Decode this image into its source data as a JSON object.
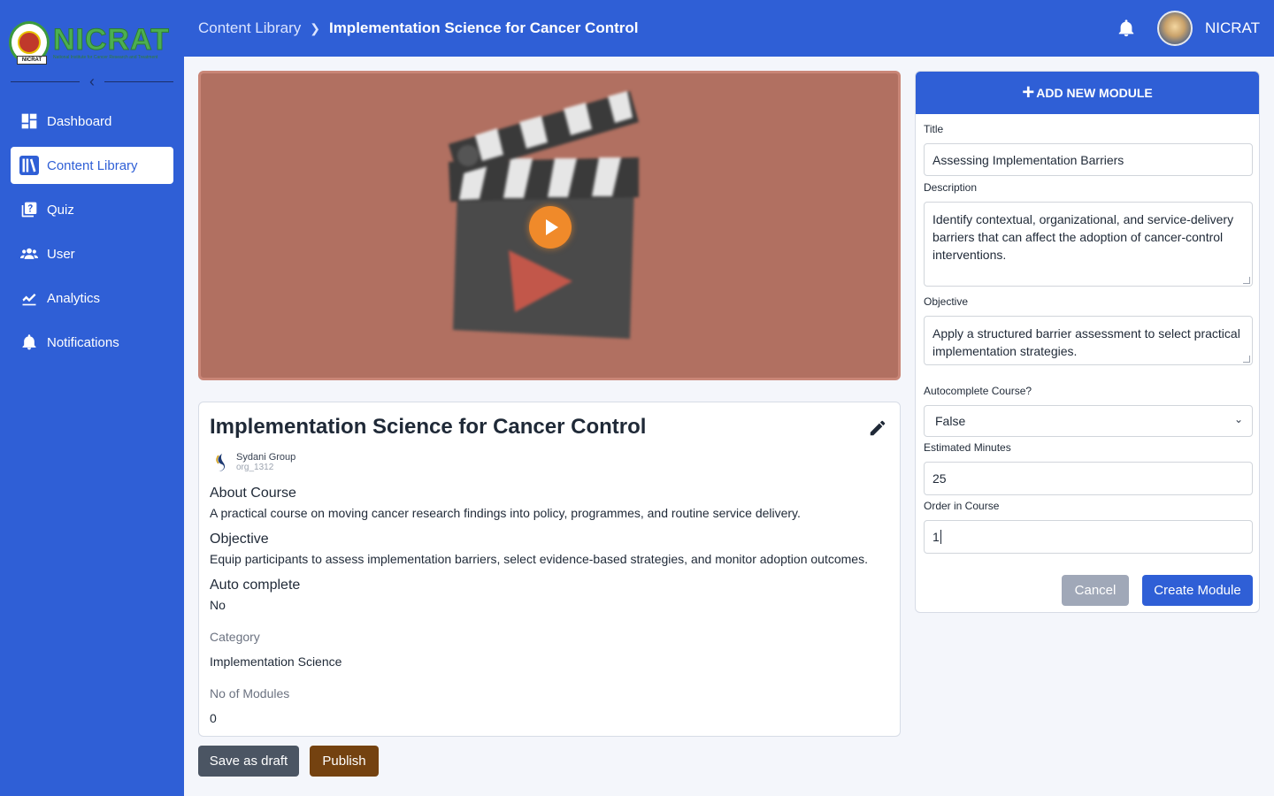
{
  "brand": {
    "name": "NICRAT",
    "tagline": "National Institute for Cancer Research and Treatment",
    "seal_label": "NICRAT",
    "primary_color": "#2f5fd6"
  },
  "sidebar": {
    "items": [
      {
        "label": "Dashboard",
        "icon": "dashboard-icon",
        "active": false
      },
      {
        "label": "Content Library",
        "icon": "library-icon",
        "active": true
      },
      {
        "label": "Quiz",
        "icon": "quiz-icon",
        "active": false
      },
      {
        "label": "User",
        "icon": "users-icon",
        "active": false
      },
      {
        "label": "Analytics",
        "icon": "analytics-icon",
        "active": false
      },
      {
        "label": "Notifications",
        "icon": "bell-icon",
        "active": false
      }
    ]
  },
  "header": {
    "breadcrumb_root": "Content Library",
    "breadcrumb_current": "Implementation Science for Cancer Control",
    "user_name": "NICRAT"
  },
  "course": {
    "title": "Implementation Science for Cancer Control",
    "org_name": "Sydani Group",
    "org_id": "org_1312",
    "about_heading": "About Course",
    "about_text": "A practical course on moving cancer research findings into policy, programmes, and routine service delivery.",
    "objective_heading": "Objective",
    "objective_text": "Equip participants to assess implementation barriers, select evidence-based strategies, and monitor adoption outcomes.",
    "autocomplete_heading": "Auto complete",
    "autocomplete_value": "No",
    "category_label": "Category",
    "category_value": "Implementation Science",
    "modules_label": "No of Modules",
    "modules_value": "0"
  },
  "actions": {
    "save_draft": "Save as draft",
    "publish": "Publish"
  },
  "module_form": {
    "header": "ADD NEW MODULE",
    "title_label": "Title",
    "title_value": "Assessing Implementation Barriers",
    "description_label": "Description",
    "description_value": "Identify contextual, organizational, and service-delivery barriers that can affect the adoption of cancer-control interventions.",
    "objective_label": "Objective",
    "objective_value": "Apply a structured barrier assessment to select practical implementation strategies.",
    "autocomplete_label": "Autocomplete Course?",
    "autocomplete_value": "False",
    "minutes_label": "Estimated Minutes",
    "minutes_value": "25",
    "order_label": "Order in Course",
    "order_value": "1",
    "cancel": "Cancel",
    "create": "Create Module"
  }
}
